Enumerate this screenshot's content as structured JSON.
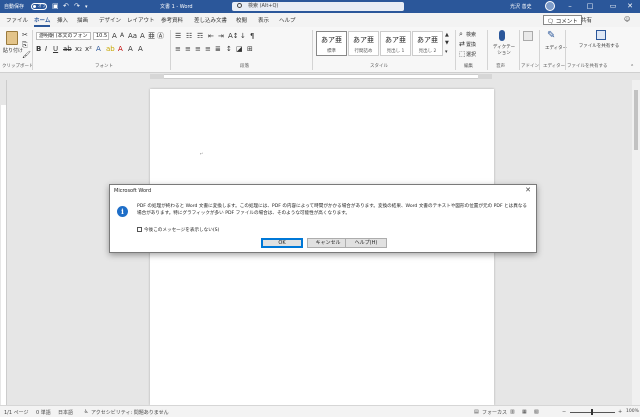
{
  "titlebar": {
    "autosave_label": "自動保存",
    "autosave_state": "オフ",
    "doc_title": "文書 1  -  Word",
    "search_placeholder": "検索 (Alt+Q)",
    "user_name": "光沢 善史"
  },
  "tabs": [
    "ファイル",
    "ホーム",
    "挿入",
    "描画",
    "デザイン",
    "レイアウト",
    "参考資料",
    "差し込み文書",
    "校閲",
    "表示",
    "ヘルプ"
  ],
  "active_tab": "ホーム",
  "tab_actions": {
    "comment": "コメント",
    "share": "共有"
  },
  "ribbon": {
    "clipboard": {
      "paste": "貼り付け",
      "label": "クリップボード"
    },
    "font": {
      "font_name": "游明朝 (本文のフォン",
      "font_size": "10.5",
      "label": "フォント"
    },
    "paragraph": {
      "label": "段落"
    },
    "styles": {
      "label": "スタイル",
      "items": [
        {
          "sample": "あア亜",
          "name": "標準"
        },
        {
          "sample": "あア亜",
          "name": "行間詰め"
        },
        {
          "sample": "あア亜",
          "name": "見出し 1"
        },
        {
          "sample": "あア亜",
          "name": "見出し 2"
        }
      ]
    },
    "editing": {
      "find": "検索",
      "replace": "置換",
      "select": "選択",
      "label": "編集"
    },
    "voice": {
      "dictate": "ディクテーション",
      "label": "音声"
    },
    "addin": {
      "label": "アドイン"
    },
    "editor": {
      "name": "エディター",
      "label": "エディター"
    },
    "share_file": {
      "name": "ファイルを共有する",
      "label": "ファイルを共有する"
    }
  },
  "dialog": {
    "title": "Microsoft Word",
    "message": "PDF の処理が終わると Word 文書に変換します。この処理には、PDF の内容によって時間がかかる場合があります。変換の結果、Word 文書のテキストや図形の位置が元の PDF とは異なる場合があります。特にグラフィックが多い PDF ファイルの場合は、そのような可能性が高くなります。",
    "checkbox_label": "今後このメッセージを表示しない(S)",
    "ok": "OK",
    "cancel": "キャンセル",
    "help": "ヘルプ(H)"
  },
  "status": {
    "page": "1/1 ページ",
    "words": "0 単語",
    "language": "日本語",
    "accessibility": "アクセシビリティ: 問題ありません",
    "focus": "フォーカス",
    "zoom": "100%"
  },
  "colors": {
    "accent": "#2b579a",
    "dialog_default": "#0078d7",
    "info": "#1e6ec8"
  }
}
